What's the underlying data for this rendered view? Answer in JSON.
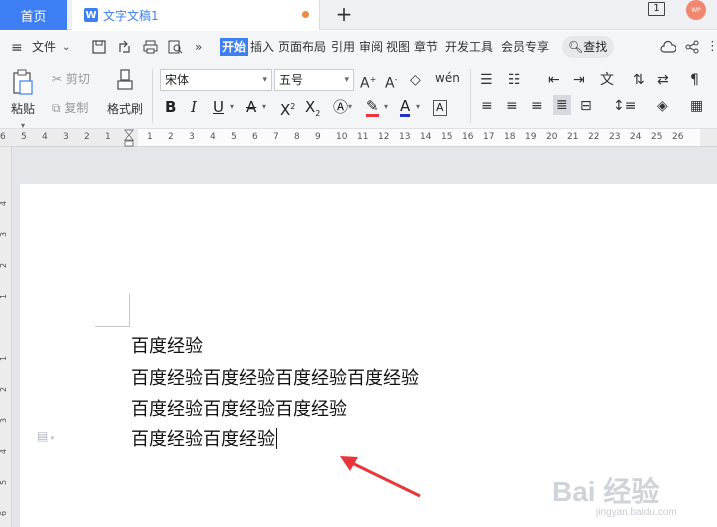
{
  "tabs": {
    "home": "首页",
    "document": "文字文稿1",
    "document_icon": "W",
    "new_tab": "+",
    "window_count": "1",
    "avatar": "WP"
  },
  "menu": {
    "file": "文件",
    "items": [
      "开始",
      "插入",
      "页面布局",
      "引用",
      "审阅",
      "视图",
      "章节",
      "开发工具",
      "会员专享"
    ],
    "active": "开始",
    "search": "查找"
  },
  "ribbon": {
    "paste": "粘贴",
    "cut": "剪切",
    "copy": "复制",
    "format_painter": "格式刷",
    "font_name": "宋体",
    "font_size": "五号"
  },
  "ruler": {
    "ticks": [
      "6",
      "5",
      "4",
      "3",
      "2",
      "1",
      "",
      "1",
      "2",
      "3",
      "4",
      "5",
      "6",
      "7",
      "8",
      "9",
      "10",
      "11",
      "12",
      "13",
      "14",
      "15",
      "16",
      "17",
      "18",
      "19",
      "20",
      "21",
      "22",
      "23",
      "24",
      "25",
      "26"
    ],
    "vertical_ticks": [
      "4",
      "3",
      "2",
      "1",
      "",
      "1",
      "2",
      "3",
      "4",
      "5",
      "6"
    ]
  },
  "document": {
    "lines": [
      "百度经验",
      "百度经验百度经验百度经验百度经验",
      "百度经验百度经验百度经验",
      "百度经验百度经验"
    ]
  },
  "watermark": {
    "main": "Bai 经验",
    "url": "jingyan.baidu.com"
  },
  "colors": {
    "accent": "#3d7ef5",
    "arrow": "#e8363b",
    "font_color_red": "#e8363b",
    "font_color_blue": "#2331c6"
  }
}
